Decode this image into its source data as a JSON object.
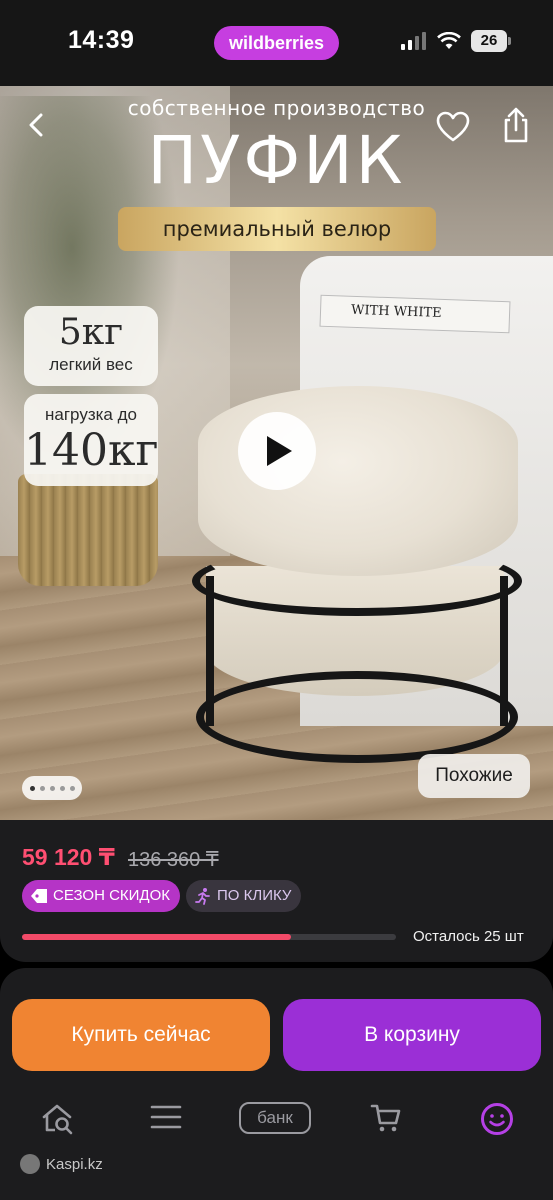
{
  "status_bar": {
    "time": "14:39",
    "app_pill": "wildberries",
    "battery": "26",
    "icons": [
      "signal-icon",
      "wifi-icon",
      "battery-icon"
    ]
  },
  "hero": {
    "subtitle": "собственное производство",
    "title": "ПУФИК",
    "material_badge": "премиальный велюр",
    "weight_value": "5кг",
    "weight_label": "легкий вес",
    "load_label": "нагрузка до",
    "load_value": "140кг",
    "book_text": "WITH WHITE",
    "similar_button": "Похожие",
    "gallery": {
      "total": 5,
      "current": 1
    },
    "icons": [
      "back-arrow-icon",
      "heart-icon",
      "share-icon",
      "play-icon"
    ]
  },
  "price": {
    "current": "59 120 ₸",
    "old": "136 360 ₸",
    "badges": [
      {
        "label": "СЕЗОН СКИДОК",
        "icon": "tag-icon"
      },
      {
        "label": "ПО КЛИКУ",
        "icon": "running-person-icon"
      }
    ],
    "stock_fraction": 0.72,
    "stock_text": "Осталось 25 шт"
  },
  "actions": {
    "buy_now": "Купить сейчас",
    "add_to_cart": "В корзину"
  },
  "tabbar": {
    "bank_label": "банк",
    "items": [
      "home-search-icon",
      "catalog-icon",
      "bank-icon",
      "cart-icon",
      "profile-icon"
    ]
  },
  "watermark": "Kaspi.kz",
  "colors": {
    "brand_pink": "#c63ee0",
    "price_red": "#ff4f72",
    "buy_orange": "#f08432",
    "cart_purple": "#9b2fd6",
    "sale_badge": "#b534c6",
    "active_tab": "#b540e6"
  }
}
